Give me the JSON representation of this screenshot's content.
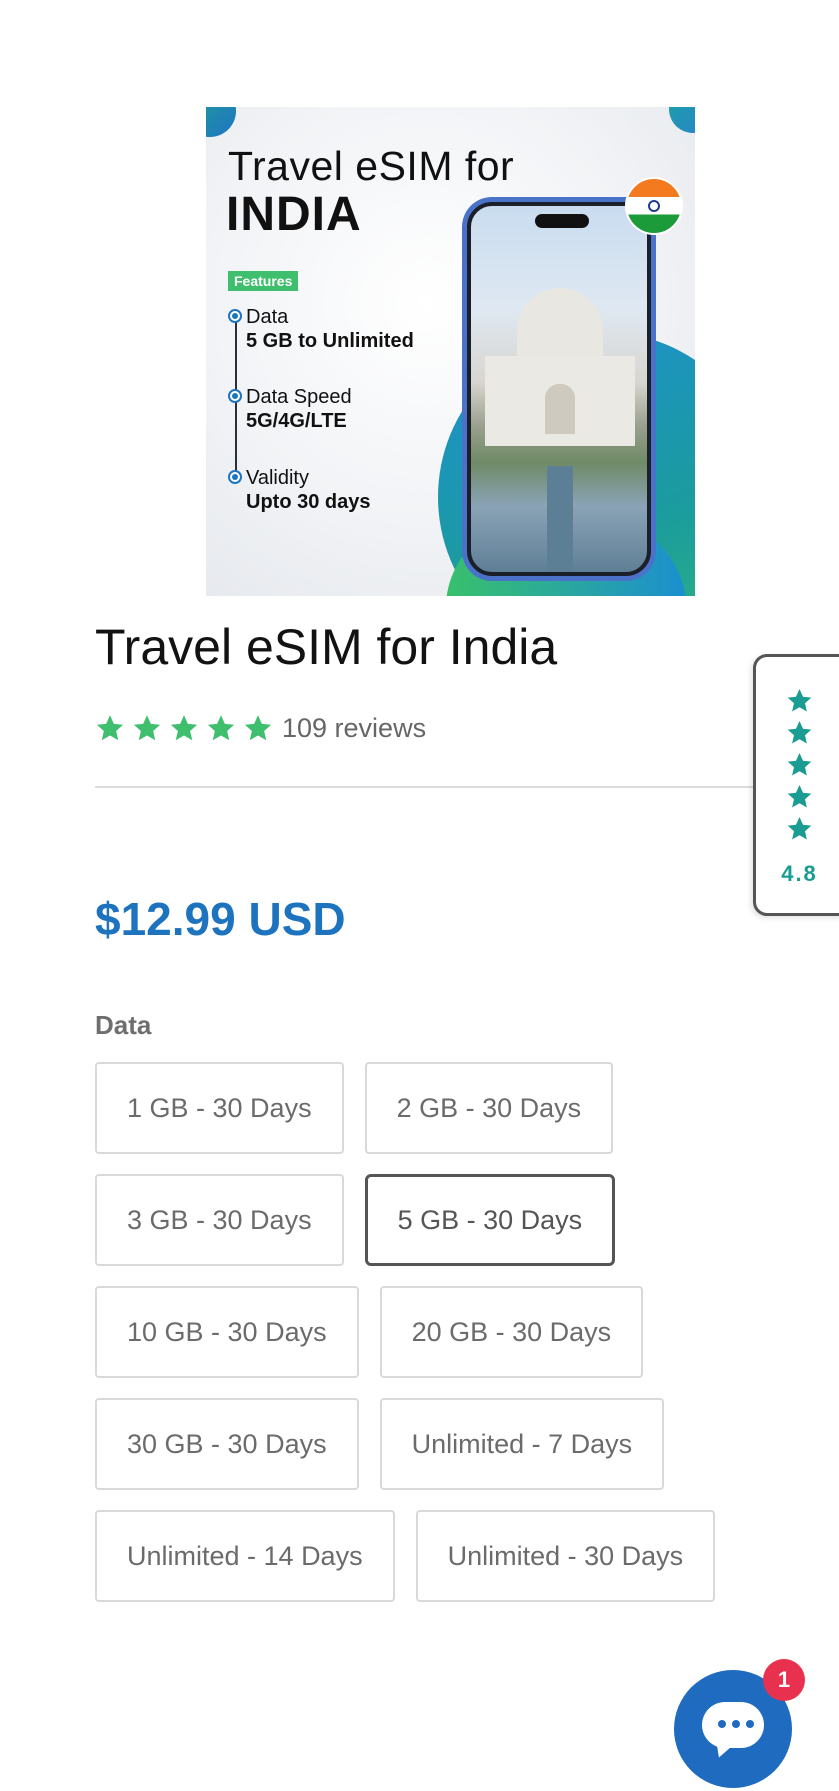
{
  "hero": {
    "title": "Travel eSIM for",
    "country": "INDIA",
    "badge": "Features",
    "features": [
      {
        "label": "Data",
        "value": "5 GB to Unlimited"
      },
      {
        "label": "Data Speed",
        "value": "5G/4G/LTE"
      },
      {
        "label": "Validity",
        "value": "Upto 30 days"
      }
    ]
  },
  "product": {
    "title": "Travel eSIM for India",
    "stars": 5,
    "reviews": "109 reviews",
    "price": "$12.99 USD"
  },
  "options": {
    "label": "Data",
    "values": [
      "1 GB - 30 Days",
      "2 GB - 30 Days",
      "3 GB - 30 Days",
      "5 GB - 30 Days",
      "10 GB - 30 Days",
      "20 GB - 30 Days",
      "30 GB - 30 Days",
      "Unlimited - 7 Days",
      "Unlimited - 14 Days",
      "Unlimited - 30 Days"
    ],
    "selected": "5 GB - 30 Days"
  },
  "rating_tab": {
    "value": "4.8"
  },
  "chat": {
    "badge": "1"
  },
  "colors": {
    "accent": "#1e73be",
    "star": "#3fbf6d",
    "tab_star": "#1a9c93",
    "badge": "#e8304f"
  }
}
